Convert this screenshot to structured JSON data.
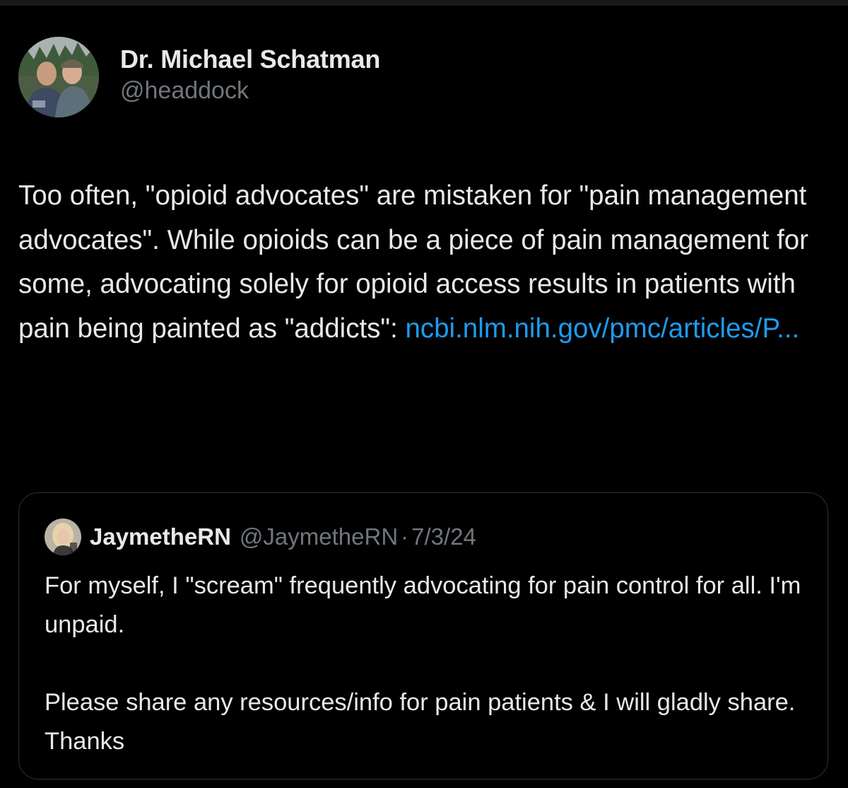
{
  "tweet": {
    "author": {
      "display_name": "Dr. Michael Schatman",
      "handle": "@headdock"
    },
    "text": "Too often, \"opioid advocates\" are mistaken for \"pain management advocates\". While opioids can be a piece of pain management for some, advocating solely for opioid access results in patients with pain being painted as \"addicts\": ",
    "link_text": "ncbi.nlm.nih.gov/pmc/articles/P..."
  },
  "quote": {
    "display_name": "JaymetheRN",
    "handle": "@JaymetheRN",
    "separator": "·",
    "date": "7/3/24",
    "paragraphs": [
      "For myself, I \"scream\" frequently advocating for pain control for all. I'm unpaid.",
      "Please share any resources/info for pain patients & I will gladly share. Thanks"
    ]
  },
  "colors": {
    "background": "#000000",
    "text_primary": "#e7e9ea",
    "text_secondary": "#71767b",
    "link": "#1d9bf0",
    "border": "#2f3336"
  },
  "icons": {
    "author_avatar": "author-avatar",
    "quote_avatar": "quote-author-avatar"
  }
}
